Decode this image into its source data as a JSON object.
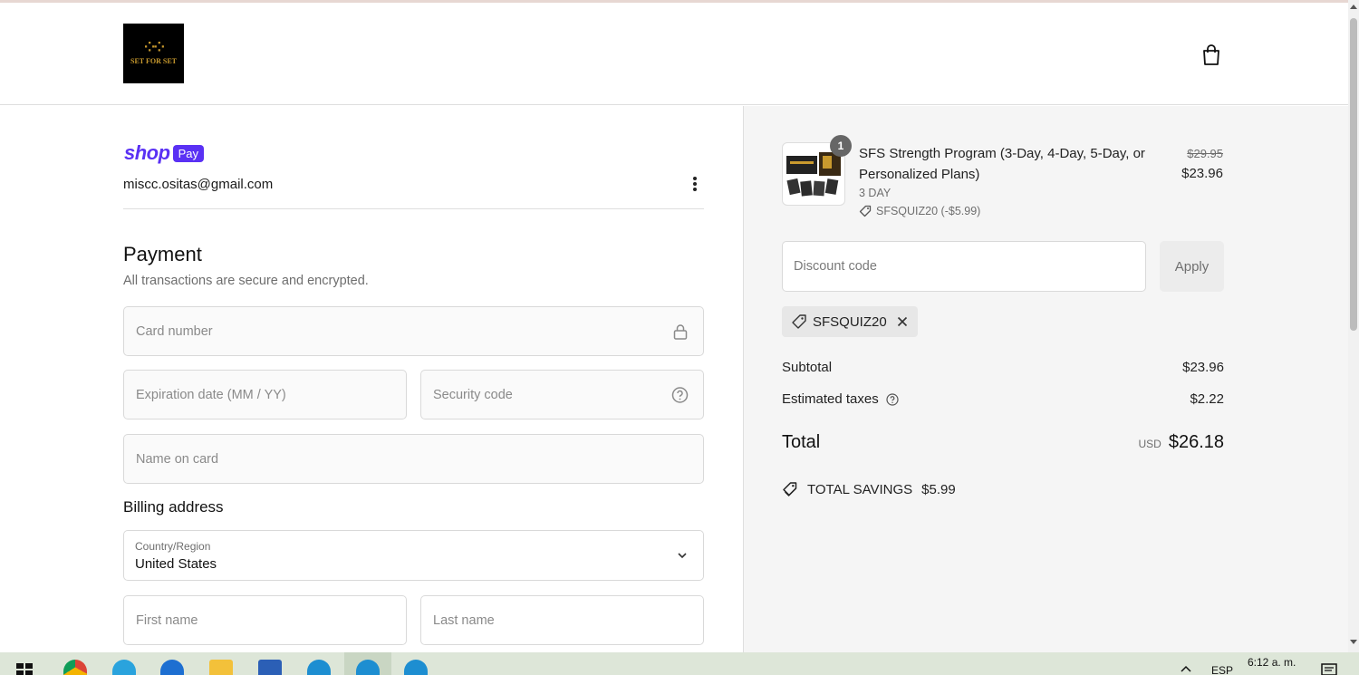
{
  "header": {
    "logo_text": "SET FOR SET",
    "cart_icon": "shopping-bag-icon"
  },
  "account": {
    "shop_word": "shop",
    "pay_badge": "Pay",
    "email": "miscc.ositas@gmail.com",
    "menu_icon": "more-vertical-icon"
  },
  "payment": {
    "title": "Payment",
    "subtitle": "All transactions are secure and encrypted.",
    "card_number_placeholder": "Card number",
    "expiration_placeholder": "Expiration date (MM / YY)",
    "security_code_placeholder": "Security code",
    "name_on_card_placeholder": "Name on card"
  },
  "billing": {
    "title": "Billing address",
    "country_label": "Country/Region",
    "country_value": "United States",
    "first_name_placeholder": "First name",
    "last_name_placeholder": "Last name"
  },
  "order": {
    "quantity": "1",
    "product_name": "SFS Strength Program (3-Day, 4-Day, 5-Day, or Personalized Plans)",
    "variant": "3 DAY",
    "applied_code_line": "SFSQUIZ20 (-$5.99)",
    "original_price": "$29.95",
    "price": "$23.96",
    "discount_placeholder": "Discount code",
    "apply_label": "Apply",
    "chip_code": "SFSQUIZ20",
    "subtotal_label": "Subtotal",
    "subtotal_value": "$23.96",
    "taxes_label": "Estimated taxes",
    "taxes_value": "$2.22",
    "total_label": "Total",
    "currency": "USD",
    "total_value": "$26.18",
    "savings_label": "TOTAL SAVINGS",
    "savings_value": "$5.99"
  },
  "taskbar": {
    "language": "ESP",
    "time": "6:12 a. m."
  },
  "colors": {
    "shop_purple": "#5a31f4",
    "summary_bg": "#f5f5f5",
    "taskbar_bg": "#dde6d8"
  }
}
